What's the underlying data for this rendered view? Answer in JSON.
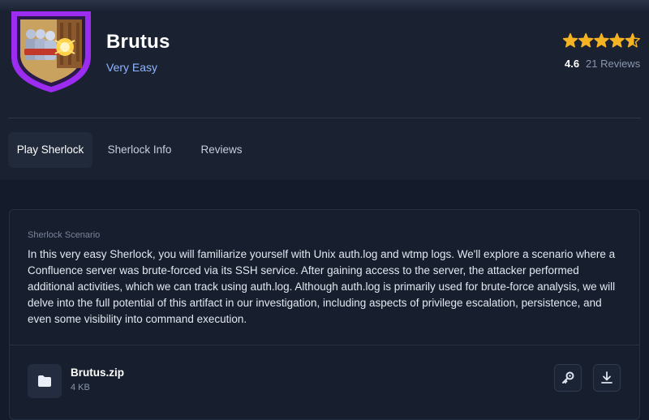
{
  "challenge": {
    "title": "Brutus",
    "difficulty": "Very Easy",
    "badge_icon": "sherlock-badge-icon"
  },
  "rating": {
    "score": "4.6",
    "score_value": 4.6,
    "max_stars": 5,
    "reviews": "21 Reviews",
    "star_color": "#f5b323"
  },
  "tabs": [
    {
      "label": "Play Sherlock",
      "active": true
    },
    {
      "label": "Sherlock Info",
      "active": false
    },
    {
      "label": "Reviews",
      "active": false
    }
  ],
  "scenario": {
    "label": "Sherlock Scenario",
    "text": "In this very easy Sherlock, you will familiarize yourself with Unix auth.log and wtmp logs. We'll explore a scenario where a Confluence server was brute-forced via its SSH service. After gaining access to the server, the attacker performed additional activities, which we can track using auth.log. Although auth.log is primarily used for brute-force analysis, we will delve into the full potential of this artifact in our investigation, including aspects of privilege escalation, persistence, and even some visibility into command execution."
  },
  "file": {
    "name": "Brutus.zip",
    "size": "4 KB",
    "icon": "folder-icon",
    "actions": [
      "key-icon",
      "download-icon"
    ]
  },
  "colors": {
    "background": "#141b2a",
    "accent_purple": "#9b2cf0",
    "link_blue": "#8fb5ff"
  }
}
